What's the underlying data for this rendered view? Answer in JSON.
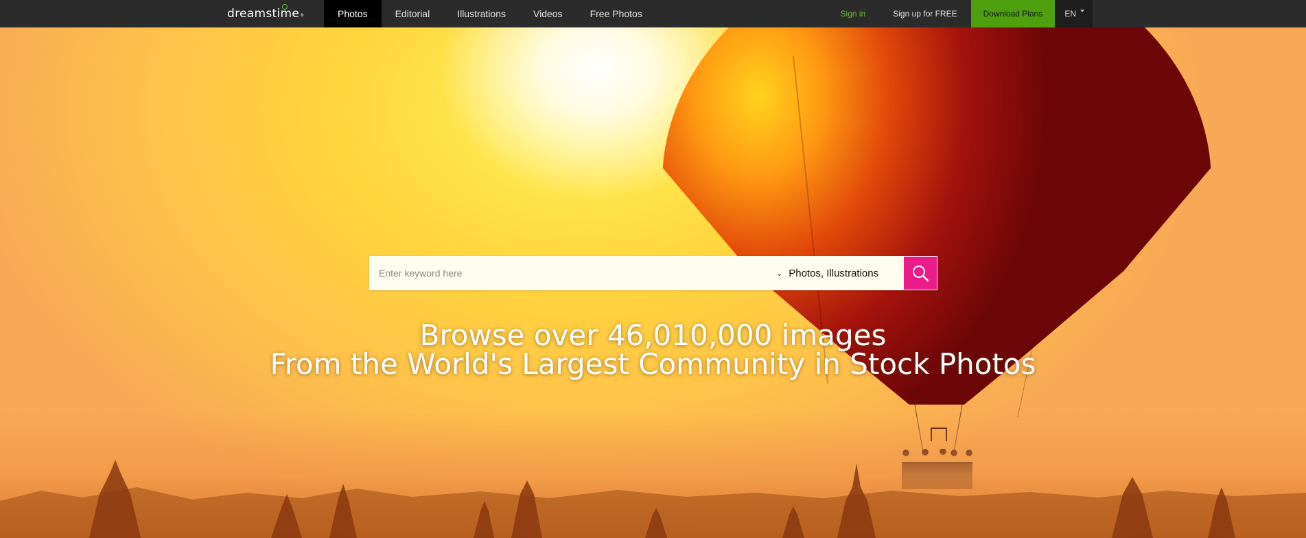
{
  "brand": {
    "name": "dreamstime",
    "reg_mark": "®"
  },
  "nav": {
    "items": [
      {
        "label": "Photos",
        "active": true
      },
      {
        "label": "Editorial",
        "active": false
      },
      {
        "label": "Illustrations",
        "active": false
      },
      {
        "label": "Videos",
        "active": false
      },
      {
        "label": "Free Photos",
        "active": false
      }
    ]
  },
  "account": {
    "sign_in": "Sign in",
    "sign_up": "Sign up for FREE",
    "download_plans": "Download Plans",
    "language": "EN"
  },
  "search": {
    "placeholder": "Enter keyword here",
    "value": "",
    "type_selected": "Photos, Illustrations",
    "button_icon": "search-icon"
  },
  "hero": {
    "line1": "Browse over 46,010,000 images",
    "line2": "From the World's Largest Community in Stock Photos"
  },
  "colors": {
    "topbar_bg": "#2b2b2b",
    "active_tab_bg": "#000000",
    "signin_green": "#6abf2e",
    "plans_green": "#4fa00f",
    "search_button_pink": "#ec1b8b"
  }
}
